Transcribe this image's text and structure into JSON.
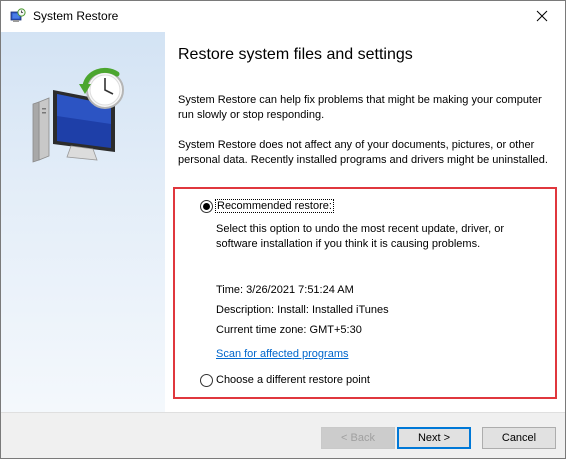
{
  "window": {
    "title": "System Restore"
  },
  "main": {
    "heading": "Restore system files and settings",
    "paragraph1": "System Restore can help fix problems that might be making your computer run slowly or stop responding.",
    "paragraph2": "System Restore does not affect any of your documents, pictures, or other personal data. Recently installed programs and drivers might be uninstalled."
  },
  "options": {
    "recommended_label": "Recommended restore:",
    "recommended_selected": true,
    "recommended_desc": "Select this option to undo the most recent update, driver, or software installation if you think it is causing problems.",
    "time": "Time: 3/26/2021 7:51:24 AM",
    "description": "Description: Install: Installed iTunes",
    "timezone": "Current time zone: GMT+5:30",
    "scan_link": "Scan for affected programs",
    "different_label": "Choose a different restore point",
    "different_selected": false
  },
  "footer": {
    "back_label": "< Back",
    "next_label": "Next >",
    "cancel_label": "Cancel"
  },
  "colors": {
    "highlight_border": "#e0373d",
    "link": "#0066cc",
    "default_button_border": "#0078d7"
  }
}
